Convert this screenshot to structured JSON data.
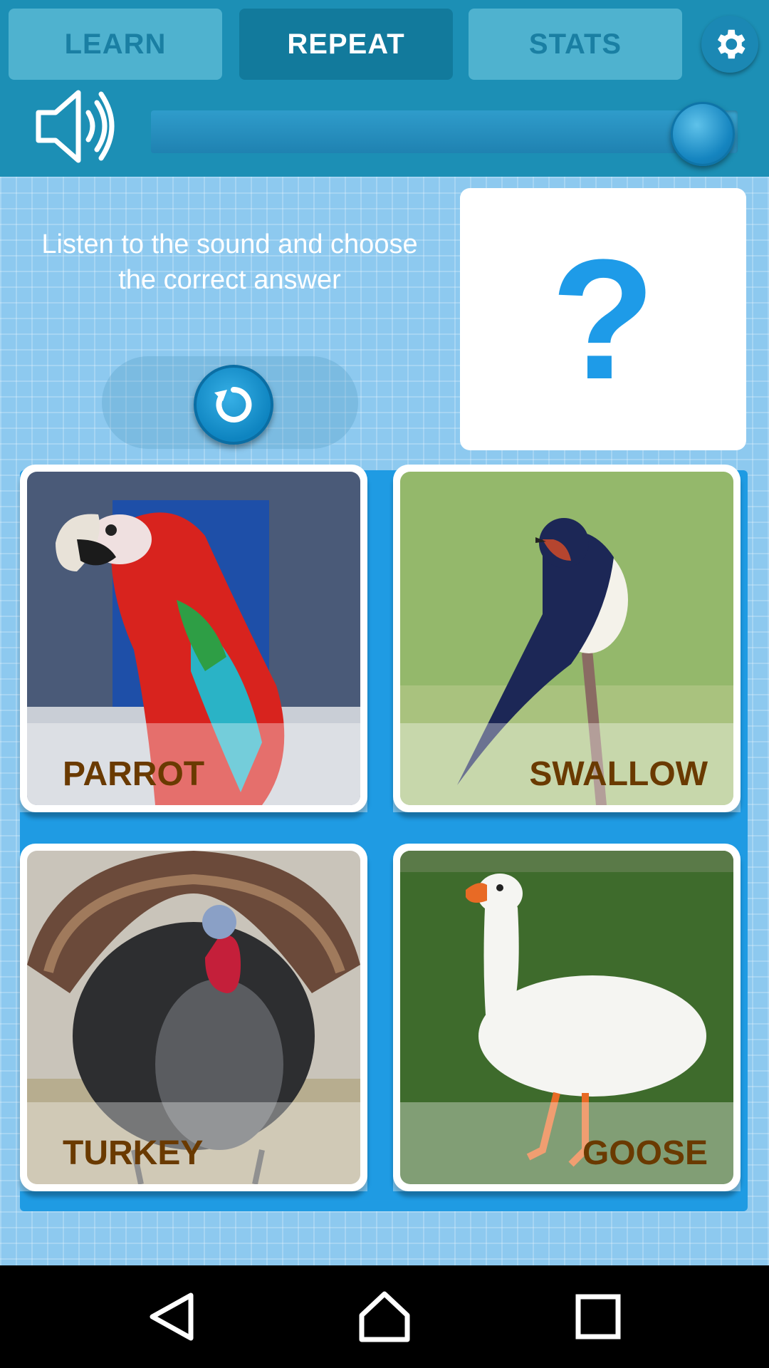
{
  "tabs": [
    {
      "label": "LEARN",
      "active": false
    },
    {
      "label": "REPEAT",
      "active": true
    },
    {
      "label": "STATS",
      "active": false
    }
  ],
  "settings_icon": "gear-icon",
  "volume": {
    "icon": "speaker-icon",
    "level": 0.94
  },
  "instruction": "Listen to the sound and choose the correct answer",
  "replay_icon": "refresh-icon",
  "question_mark": "?",
  "answers": [
    {
      "label": "PARROT",
      "image": "parrot"
    },
    {
      "label": "SWALLOW",
      "image": "swallow"
    },
    {
      "label": "TURKEY",
      "image": "turkey"
    },
    {
      "label": "GOOSE",
      "image": "goose"
    }
  ],
  "colors": {
    "accent": "#1c8fb5",
    "label_text": "#6a3a00",
    "question_mark": "#1e9be8"
  },
  "nav": {
    "back_icon": "back-icon",
    "home_icon": "home-icon",
    "recents_icon": "recents-icon"
  }
}
